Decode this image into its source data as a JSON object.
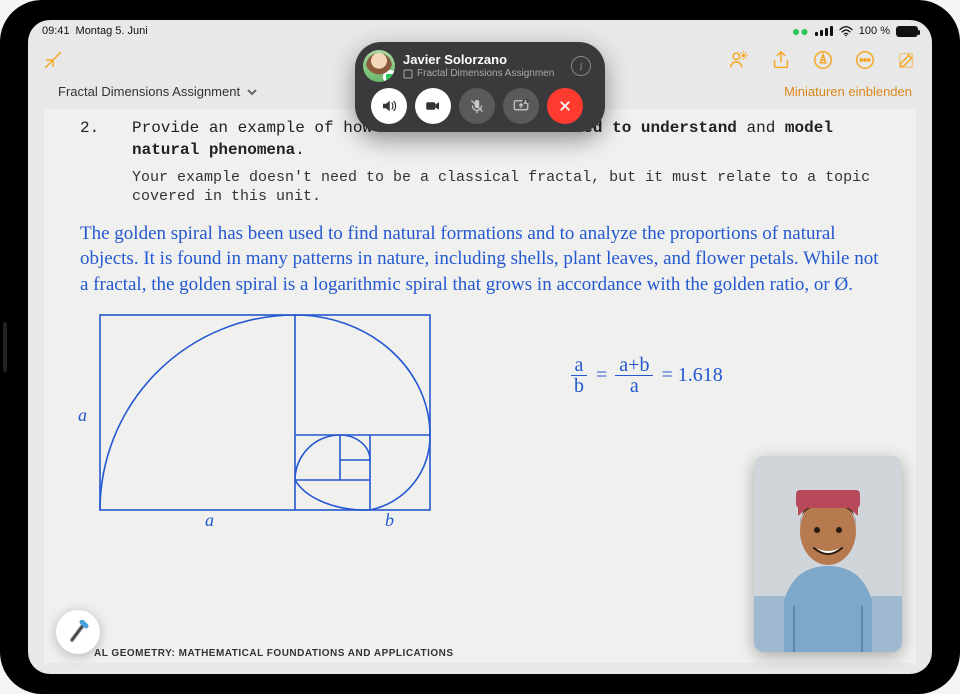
{
  "status": {
    "time": "09:41",
    "date": "Montag 5. Juni",
    "battery_pct": "100 %",
    "wifi_icon": "wifi",
    "signal_icon": "signal"
  },
  "toolbar": {
    "collapse_icon": "collapse",
    "collab": "collab",
    "share": "share",
    "format": "format",
    "more": "more",
    "compose": "compose"
  },
  "doc": {
    "title": "Fractal Dimensions Assignment",
    "thumbnails_label": "Miniaturen einblenden",
    "question_number": "2.",
    "question_line1_a": "Provide an example of how mathematics can be ",
    "question_bold1": "used to understand",
    "question_mid": " and ",
    "question_bold2": "model natural phenomena",
    "question_end": ".",
    "question_sub": "Your example doesn't need to be a classical fractal, but it must relate to a topic covered in this unit.",
    "handwriting": "The golden spiral has been used to find natural formations and to analyze the proportions of natural objects. It is found in many patterns in nature, including shells, plant leaves, and flower petals. While not a fractal, the golden spiral is a logarithmic spiral that grows in accordance with the golden ratio, or Ø.",
    "label_a": "a",
    "label_b": "b",
    "eq_frac1_top": "a",
    "eq_frac1_bot": "b",
    "eq_eq": "=",
    "eq_frac2_top": "a+b",
    "eq_frac2_bot": "a",
    "eq_result": "= 1.618",
    "footer": "AL GEOMETRY: MATHEMATICAL FOUNDATIONS AND APPLICATIONS"
  },
  "facetime": {
    "name": "Javier Solorzano",
    "subtitle": "Fractal Dimensions Assignmen",
    "buttons": {
      "audio": "speaker",
      "video": "video",
      "mute": "mic-off",
      "screenshare": "screenshare",
      "end": "end"
    }
  }
}
